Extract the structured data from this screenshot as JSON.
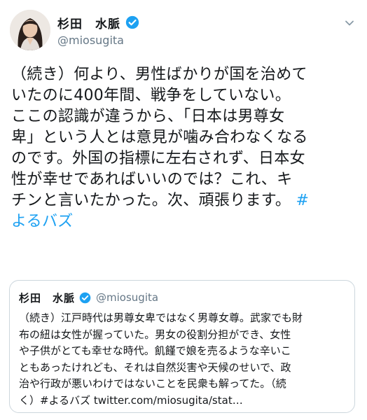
{
  "author": {
    "display_name": "杉田　水脈",
    "handle": "@miosugita",
    "verified": true,
    "avatar_icon": "profile-photo"
  },
  "tweet": {
    "text_lines": [
      "（続き）何より、男性ばかりが国を治めて",
      "いたのに400年間、戦争をしていない。",
      "ここの認識が違うから、「日本は男尊女",
      "卑」という人とは意見が噛み合わなくなる",
      "のです。外国の指標に左右されず、日本女",
      "性が幸せであればいいのでは？これ、キ",
      "チンと言いたかった。次、頑張ります。"
    ],
    "hashtag_part1": "#",
    "hashtag_part2": "よるバズ"
  },
  "quoted_tweet": {
    "display_name": "杉田　水脈",
    "handle": "@miosugita",
    "verified": true,
    "text_lines": [
      "（続き）江戸時代は男尊女卑ではなく男尊女尊。武家でも財",
      "布の紐は女性が握っていた。男女の役割分担ができ、女性",
      "や子供がとても幸せな時代。飢饉で娘を売るような辛いこ",
      "ともあったけれども、それは自然災害や天候のせいで、政",
      "治や行政が悪いわけではないことを民衆も解ってた。（続",
      "く）#よるバズ twitter.com/miosugita/stat…"
    ]
  },
  "colors": {
    "accent": "#1da1f2",
    "text": "#14171a",
    "secondary": "#657786",
    "border": "#ccd6dd"
  },
  "icons": {
    "verified": "verified-badge-icon",
    "menu": "chevron-down-icon"
  }
}
